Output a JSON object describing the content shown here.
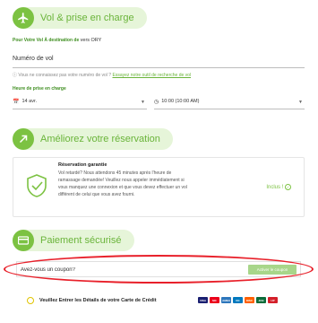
{
  "flight_section": {
    "title": "Vol & prise en charge",
    "destination_prefix": "Pour Votre Vol À destination de",
    "destination_from": "vers",
    "destination_code": "ORY",
    "flight_number_label": "Numéro de vol",
    "help_text": "Vous ne connaissez pas votre numéro de vol ?",
    "help_link": "Essayez notre outil de recherche de vol",
    "pickup_time_label": "Heure de prise en charge",
    "date_value": "14 avr.",
    "time_value": "10:00 (10:00 AM)"
  },
  "upgrade_section": {
    "title": "Améliorez votre réservation",
    "guarantee_title": "Réservation garantie",
    "guarantee_text": "Vol retardé? Nous attendons 45 minutes après l'heure de ramassage demandée! Veuillez nous appeler immédiatement si vous manquez une connexion et que vous devez effectuer un vol différent de celui que vous avez fourni.",
    "included_label": "Inclus !"
  },
  "payment_section": {
    "title": "Paiement sécurisé",
    "coupon_placeholder": "Avez-vous un coupon?",
    "coupon_button": "Activer le coupon",
    "card_option_label": "Veuillez Entrer les Détails de votre Carte de Crédit",
    "card_brands": [
      "VISA",
      "MC",
      "AMEX",
      "DC",
      "DISC",
      "JCB",
      "UP"
    ]
  },
  "colors": {
    "accent_green": "#7cc242",
    "pill_bg": "#e6f5d9",
    "annotation_red": "#e8202a"
  }
}
